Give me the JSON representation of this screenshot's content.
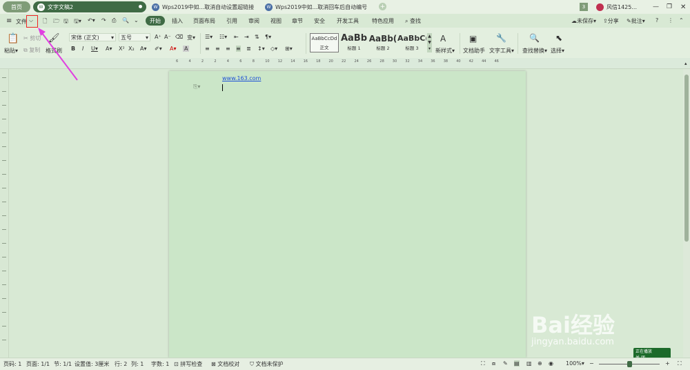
{
  "tabs": {
    "home": "首页",
    "active": "文字文稿2",
    "t1": "Wps2019中如...取消自动设置超链接",
    "t2": "Wps2019中如...取消回车后自动编号",
    "new_tab": "+",
    "badge_count": "3",
    "user": "风信1425..."
  },
  "toolbar2": {
    "file_menu": "文件",
    "menu_tabs": [
      "开始",
      "插入",
      "页面布局",
      "引用",
      "审阅",
      "视图",
      "章节",
      "安全",
      "开发工具",
      "特色应用"
    ],
    "search": "查找",
    "unsaved": "未保存",
    "share": "分享",
    "comment": "批注"
  },
  "ribbon": {
    "paste": "粘贴",
    "cut": "剪切",
    "copy": "复制",
    "format_painter": "格式刷",
    "font_name": "宋体 (正文)",
    "font_size": "五号",
    "styles": [
      {
        "preview": "AaBbCcDd",
        "label": "正文"
      },
      {
        "preview": "AaBb",
        "label": "标题 1"
      },
      {
        "preview": "AaBb(",
        "label": "标题 2"
      },
      {
        "preview": "AaBbC(",
        "label": "标题 3"
      }
    ],
    "new_style": "新样式",
    "doc_helper": "文档助手",
    "text_tools": "文字工具",
    "find_replace": "查找替换",
    "select": "选择"
  },
  "ruler": {
    "labels": [
      "6",
      "4",
      "2",
      "2",
      "4",
      "6",
      "8",
      "10",
      "12",
      "14",
      "16",
      "18",
      "20",
      "22",
      "24",
      "26",
      "28",
      "30",
      "32",
      "34",
      "36",
      "38",
      "40",
      "42",
      "44",
      "46"
    ]
  },
  "document": {
    "link_text": "www.163.com"
  },
  "status": {
    "page_num": "页码: 1",
    "pages": "页面: 1/1",
    "section": "节: 1/1",
    "setting": "设置值: 3厘米",
    "row": "行: 2",
    "col": "列: 1",
    "words": "字数: 1",
    "spell": "拼写检查",
    "proof": "文档校对",
    "protect": "文档未保护",
    "zoom": "100%"
  },
  "watermark": {
    "brand": "Bai经验",
    "url": "jingyan.baidu.com",
    "badge_line1": "正在播放",
    "badge_line2": "关 闭"
  },
  "colors": {
    "accent": "#3f6b45",
    "page_bg": "#cbe6c8",
    "annotation": "#ee2222",
    "arrow": "#e040e0",
    "link": "#1b4fd6"
  }
}
